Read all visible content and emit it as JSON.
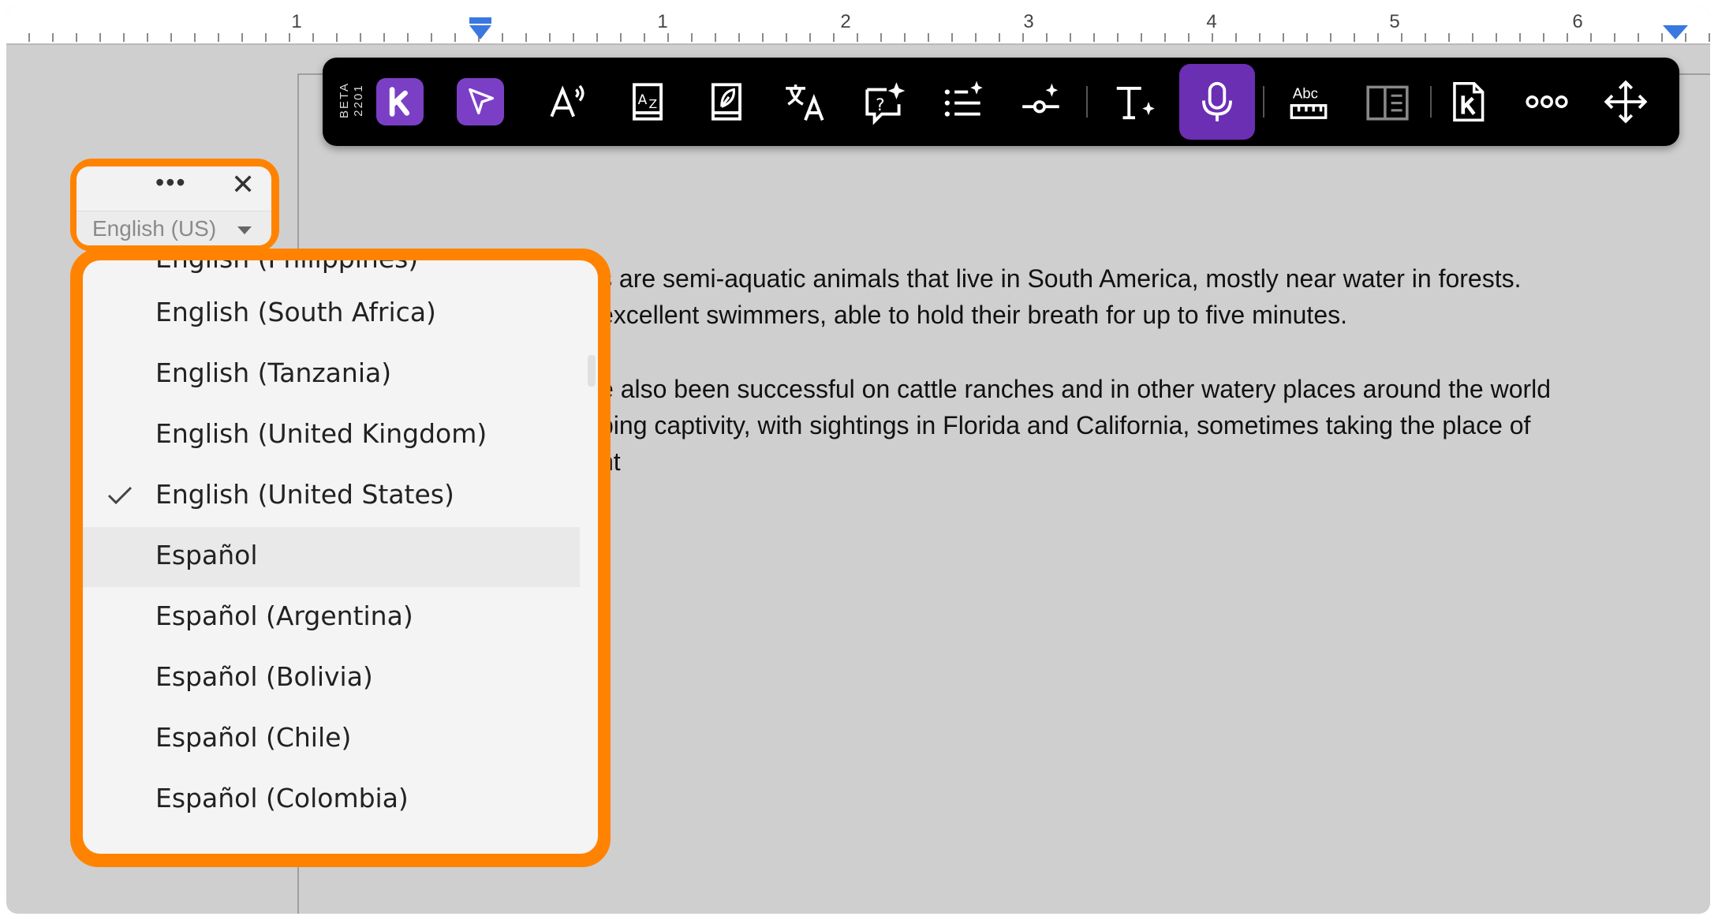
{
  "ruler": {
    "numbers": [
      "1",
      "1",
      "2",
      "3",
      "4",
      "5",
      "6"
    ]
  },
  "toolbar": {
    "beta_label": "BETA",
    "version": "2201",
    "buttons": [
      {
        "name": "kami-logo-button",
        "icon": "kami-k-icon",
        "active": true
      },
      {
        "name": "select-tool-button",
        "icon": "cursor-pointer-icon",
        "active": true
      },
      {
        "name": "read-aloud-button",
        "icon": "text-to-speech-icon"
      },
      {
        "name": "dictionary-button",
        "icon": "dictionary-icon"
      },
      {
        "name": "book-button",
        "icon": "book-icon"
      },
      {
        "name": "translate-button",
        "icon": "translate-icon"
      },
      {
        "name": "question-ai-button",
        "icon": "question-sparkle-icon"
      },
      {
        "name": "list-ai-button",
        "icon": "list-sparkle-icon"
      },
      {
        "name": "slider-ai-button",
        "icon": "slider-sparkle-icon"
      },
      {
        "name": "text-style-button",
        "icon": "text-sparkle-icon"
      },
      {
        "name": "dictation-button",
        "icon": "microphone-icon",
        "active": true
      },
      {
        "name": "spelling-ruler-button",
        "icon": "abc-ruler-icon"
      },
      {
        "name": "reader-view-button",
        "icon": "open-book-icon"
      },
      {
        "name": "kami-doc-button",
        "icon": "kami-doc-icon"
      },
      {
        "name": "more-button",
        "icon": "more-dots-icon"
      },
      {
        "name": "move-button",
        "icon": "move-arrows-icon"
      }
    ],
    "accent": "#6b2fb3"
  },
  "language_control": {
    "dots": "•••",
    "close": "✕",
    "selected_value": "English (US)"
  },
  "dropdown": {
    "partial_top_item": "English (Philippines)",
    "items": [
      {
        "label": "English (South Africa)",
        "checked": false,
        "hover": false
      },
      {
        "label": "English (Tanzania)",
        "checked": false,
        "hover": false
      },
      {
        "label": "English (United Kingdom)",
        "checked": false,
        "hover": false
      },
      {
        "label": "English (United States)",
        "checked": true,
        "hover": false
      },
      {
        "label": "Español",
        "checked": false,
        "hover": true
      },
      {
        "label": "Español (Argentina)",
        "checked": false,
        "hover": false
      },
      {
        "label": "Español (Bolivia)",
        "checked": false,
        "hover": false
      },
      {
        "label": "Español (Chile)",
        "checked": false,
        "hover": false
      },
      {
        "label": "Español (Colombia)",
        "checked": false,
        "hover": false
      }
    ],
    "highlight_color": "#ff8300"
  },
  "document": {
    "p1_line1": "s are semi-aquatic animals that live in South America, mostly near water in forests.",
    "p1_line2": "excellent swimmers, able to hold their breath for up to five minutes.",
    "p2_line1": "e also been successful on cattle ranches and in other watery places around the world",
    "p2_line2": "ping captivity, with sightings in Florida and California, sometimes taking the place of",
    "p2_line3": "nt"
  }
}
